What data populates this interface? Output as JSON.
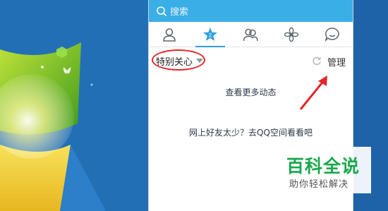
{
  "search": {
    "placeholder": "搜索"
  },
  "tabs": [
    {
      "icon": "contact-icon",
      "active": false
    },
    {
      "icon": "star-badge-icon",
      "active": true
    },
    {
      "icon": "group-icon",
      "active": false
    },
    {
      "icon": "flower-icon",
      "active": false
    },
    {
      "icon": "chat-icon",
      "active": false
    }
  ],
  "filter": {
    "label": "特别关心",
    "manage_label": "管理"
  },
  "feed": {
    "more_label": "查看更多动态",
    "empty_hint": "网上好友太少？去QQ空间看看吧"
  },
  "watermark": {
    "title": "百科全说",
    "subtitle": "助你轻松解决"
  },
  "colors": {
    "accent": "#3aaee7",
    "highlight": "#e0272c",
    "brand_green": "#1aa84b"
  }
}
